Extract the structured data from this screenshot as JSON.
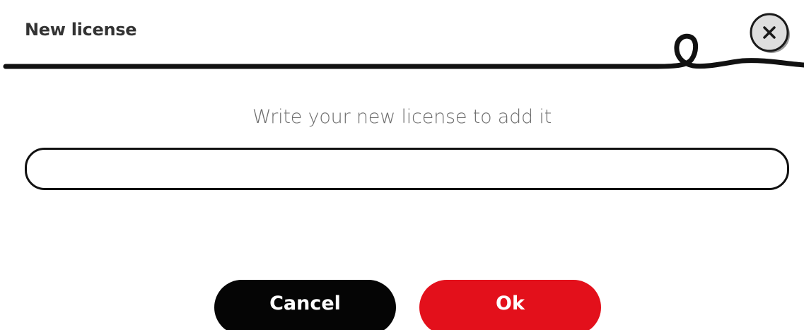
{
  "dialog": {
    "title": "New license",
    "close_icon": "close-icon",
    "subtitle": "Write your new license to add it",
    "license_input": {
      "value": "",
      "placeholder": ""
    },
    "buttons": {
      "cancel_label": "Cancel",
      "ok_label": "Ok"
    }
  },
  "colors": {
    "ok_button": "#e3101b",
    "cancel_button": "#050505",
    "title_text": "#333333",
    "subtitle_text": "#6e6e6e",
    "line": "#111111"
  }
}
